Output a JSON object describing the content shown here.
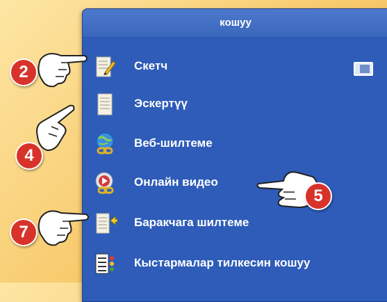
{
  "panel": {
    "title": "кошуу",
    "items": [
      {
        "label": "Скетч",
        "icon": "sketch-icon"
      },
      {
        "label": "Эскертүү",
        "icon": "note-icon"
      },
      {
        "label": "Веб-шилтеме",
        "icon": "web-link-icon"
      },
      {
        "label": "Онлайн видео",
        "icon": "online-video-icon"
      },
      {
        "label": "Баракчага шилтеме",
        "icon": "page-link-icon"
      },
      {
        "label": "Кыстармалар тилкесин кошуу",
        "icon": "bookmark-bar-icon"
      }
    ]
  },
  "callouts": [
    "2",
    "4",
    "5",
    "7"
  ],
  "colors": {
    "panel": "#2e5cb8",
    "header": "#3a67bd",
    "badge": "#d8332a",
    "background": "#f7c96a"
  }
}
